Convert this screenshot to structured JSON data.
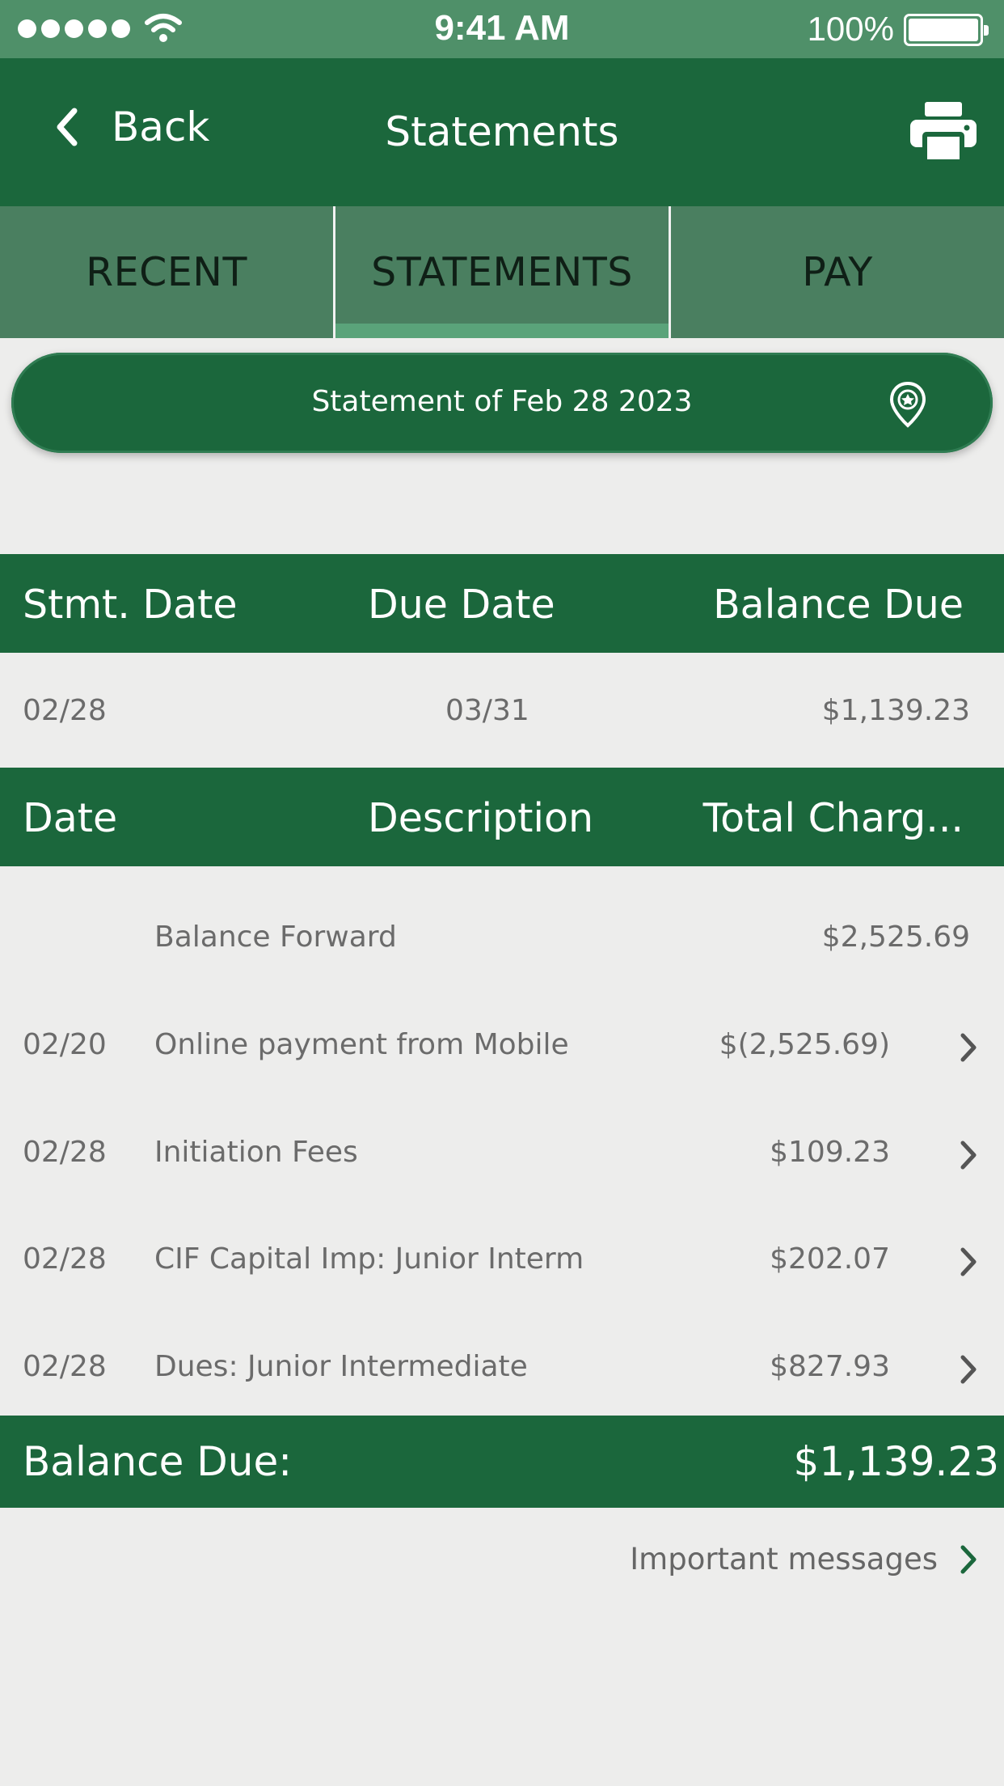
{
  "status_bar": {
    "time": "9:41 AM",
    "battery": "100%"
  },
  "nav": {
    "back_label": "Back",
    "title": "Statements"
  },
  "tabs": [
    {
      "label": "RECENT",
      "active": false
    },
    {
      "label": "STATEMENTS",
      "active": true
    },
    {
      "label": "PAY",
      "active": false
    }
  ],
  "statement_selector": {
    "label": "Statement of Feb 28 2023"
  },
  "summary": {
    "headers": [
      "Stmt. Date",
      "Due Date",
      "Balance Due"
    ],
    "row": {
      "stmt_date": "02/28",
      "due_date": "03/31",
      "balance_due": "$1,139.23"
    }
  },
  "transactions": {
    "headers": [
      "Date",
      "Description",
      "Total Charg..."
    ],
    "rows": [
      {
        "date": "",
        "description": "Balance Forward",
        "amount": "$2,525.69",
        "has_detail": false
      },
      {
        "date": "02/20",
        "description": "Online payment from Mobile",
        "amount": "$(2,525.69)",
        "has_detail": true
      },
      {
        "date": "02/28",
        "description": "Initiation Fees",
        "amount": "$109.23",
        "has_detail": true
      },
      {
        "date": "02/28",
        "description": "CIF Capital Imp: Junior Interm",
        "amount": "$202.07",
        "has_detail": true
      },
      {
        "date": "02/28",
        "description": "Dues: Junior Intermediate",
        "amount": "$827.93",
        "has_detail": true
      }
    ]
  },
  "balance": {
    "label": "Balance Due:",
    "value": "$1,139.23"
  },
  "messages_link": {
    "label": "Important messages"
  },
  "colors": {
    "primary": "#1b673c",
    "status_bar": "#4f9069",
    "tabs": "#4a7f60",
    "background": "#ededec"
  }
}
